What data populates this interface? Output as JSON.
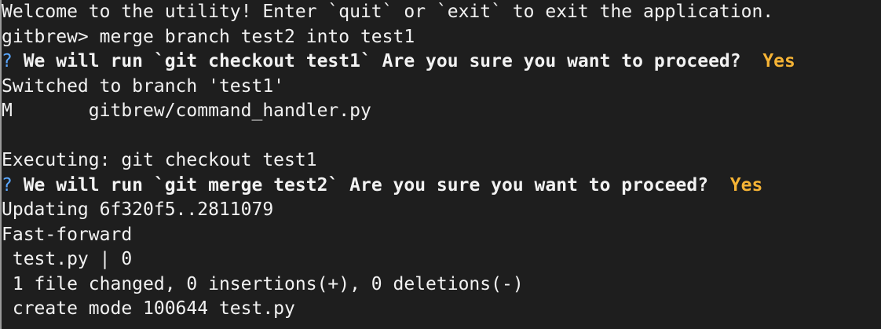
{
  "terminal": {
    "lines": [
      {
        "text": "Welcome to the utility! Enter `quit` or `exit` to exit the application."
      },
      {
        "text": "gitbrew> merge branch test2 into test1"
      },
      {
        "q": "?",
        "text": " We will run `git checkout test1` Are you sure you want to proceed?  ",
        "answer": "Yes"
      },
      {
        "text": "Switched to branch 'test1'"
      },
      {
        "text": "M       gitbrew/command_handler.py"
      },
      {
        "text": ""
      },
      {
        "text": "Executing: git checkout test1"
      },
      {
        "q": "?",
        "text": " We will run `git merge test2` Are you sure you want to proceed?  ",
        "answer": "Yes"
      },
      {
        "text": "Updating 6f320f5..2811079"
      },
      {
        "text": "Fast-forward"
      },
      {
        "text": " test.py | 0"
      },
      {
        "text": " 1 file changed, 0 insertions(+), 0 deletions(-)"
      },
      {
        "text": " create mode 100644 test.py"
      }
    ]
  },
  "colors": {
    "background": "#1e1e1e",
    "text": "#f2f2f2",
    "prompt_question": "#5aa7ff",
    "answer": "#f5b335"
  }
}
